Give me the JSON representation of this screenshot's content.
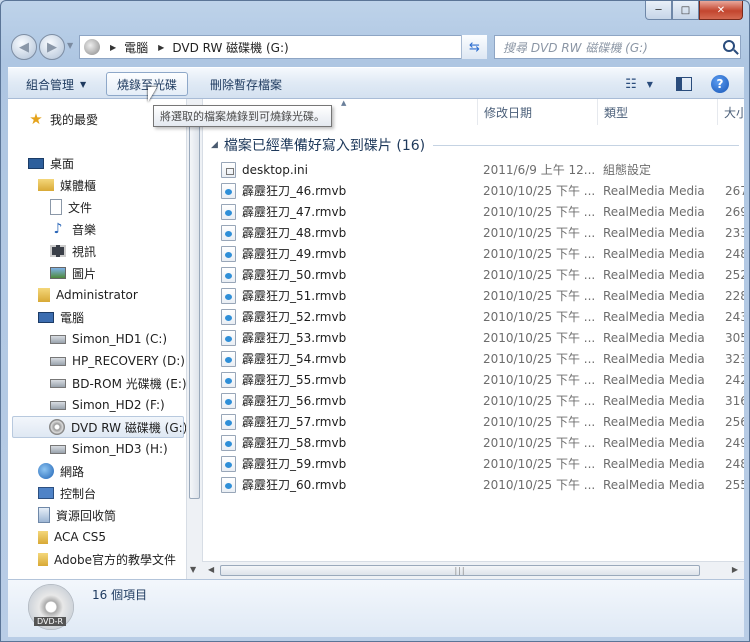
{
  "window": {
    "caption": {
      "minimize": "─",
      "maximize": "□",
      "close": "✕"
    }
  },
  "address": {
    "crumbs": [
      "電腦",
      "DVD RW 磁碟機 (G:)"
    ]
  },
  "search": {
    "placeholder": "搜尋 DVD RW 磁碟機 (G:)"
  },
  "toolbar": {
    "organize": "組合管理",
    "burn": "燒錄至光碟",
    "delete_temp": "刪除暫存檔案",
    "tooltip": "將選取的檔案燒錄到可燒錄光碟。"
  },
  "nav": {
    "items": [
      {
        "label": "我的最愛",
        "icon": "star-icon"
      },
      {
        "label": "桌面",
        "icon": "desktop-icon"
      },
      {
        "label": "媒體櫃",
        "icon": "library-icon"
      },
      {
        "label": "文件",
        "icon": "documents-icon"
      },
      {
        "label": "音樂",
        "icon": "music-icon"
      },
      {
        "label": "視訊",
        "icon": "video-icon"
      },
      {
        "label": "圖片",
        "icon": "pictures-icon"
      },
      {
        "label": "Administrator",
        "icon": "user-folder-icon"
      },
      {
        "label": "電腦",
        "icon": "computer-icon"
      },
      {
        "label": "Simon_HD1 (C:)",
        "icon": "system-drive-icon"
      },
      {
        "label": "HP_RECOVERY (D:)",
        "icon": "drive-icon"
      },
      {
        "label": "BD-ROM 光碟機 (E:)",
        "icon": "optical-drive-icon"
      },
      {
        "label": "Simon_HD2 (F:)",
        "icon": "drive-icon"
      },
      {
        "label": "DVD RW 磁碟機 (G:)",
        "icon": "dvd-drive-icon"
      },
      {
        "label": "Simon_HD3 (H:)",
        "icon": "drive-icon"
      },
      {
        "label": "網路",
        "icon": "network-icon"
      },
      {
        "label": "控制台",
        "icon": "control-panel-icon"
      },
      {
        "label": "資源回收筒",
        "icon": "recycle-bin-icon"
      },
      {
        "label": "ACA CS5",
        "icon": "folder-icon"
      },
      {
        "label": "Adobe官方的教學文件",
        "icon": "folder-icon"
      }
    ]
  },
  "columns": {
    "date": "修改日期",
    "type": "類型",
    "size": "大小"
  },
  "group": {
    "label": "檔案已經準備好寫入到碟片 (16)"
  },
  "files": [
    {
      "name": "desktop.ini",
      "date": "2011/6/9 上午 12...",
      "type": "組態設定",
      "size": "",
      "kind": "ini"
    },
    {
      "name": "霹靂狂刀_46.rmvb",
      "date": "2010/10/25 下午 ...",
      "type": "RealMedia Media",
      "size": "267",
      "kind": "media"
    },
    {
      "name": "霹靂狂刀_47.rmvb",
      "date": "2010/10/25 下午 ...",
      "type": "RealMedia Media",
      "size": "269",
      "kind": "media"
    },
    {
      "name": "霹靂狂刀_48.rmvb",
      "date": "2010/10/25 下午 ...",
      "type": "RealMedia Media",
      "size": "233",
      "kind": "media"
    },
    {
      "name": "霹靂狂刀_49.rmvb",
      "date": "2010/10/25 下午 ...",
      "type": "RealMedia Media",
      "size": "248",
      "kind": "media"
    },
    {
      "name": "霹靂狂刀_50.rmvb",
      "date": "2010/10/25 下午 ...",
      "type": "RealMedia Media",
      "size": "252",
      "kind": "media"
    },
    {
      "name": "霹靂狂刀_51.rmvb",
      "date": "2010/10/25 下午 ...",
      "type": "RealMedia Media",
      "size": "228",
      "kind": "media"
    },
    {
      "name": "霹靂狂刀_52.rmvb",
      "date": "2010/10/25 下午 ...",
      "type": "RealMedia Media",
      "size": "243",
      "kind": "media"
    },
    {
      "name": "霹靂狂刀_53.rmvb",
      "date": "2010/10/25 下午 ...",
      "type": "RealMedia Media",
      "size": "305",
      "kind": "media"
    },
    {
      "name": "霹靂狂刀_54.rmvb",
      "date": "2010/10/25 下午 ...",
      "type": "RealMedia Media",
      "size": "323",
      "kind": "media"
    },
    {
      "name": "霹靂狂刀_55.rmvb",
      "date": "2010/10/25 下午 ...",
      "type": "RealMedia Media",
      "size": "242",
      "kind": "media"
    },
    {
      "name": "霹靂狂刀_56.rmvb",
      "date": "2010/10/25 下午 ...",
      "type": "RealMedia Media",
      "size": "316",
      "kind": "media"
    },
    {
      "name": "霹靂狂刀_57.rmvb",
      "date": "2010/10/25 下午 ...",
      "type": "RealMedia Media",
      "size": "256",
      "kind": "media"
    },
    {
      "name": "霹靂狂刀_58.rmvb",
      "date": "2010/10/25 下午 ...",
      "type": "RealMedia Media",
      "size": "249",
      "kind": "media"
    },
    {
      "name": "霹靂狂刀_59.rmvb",
      "date": "2010/10/25 下午 ...",
      "type": "RealMedia Media",
      "size": "248",
      "kind": "media"
    },
    {
      "name": "霹靂狂刀_60.rmvb",
      "date": "2010/10/25 下午 ...",
      "type": "RealMedia Media",
      "size": "255",
      "kind": "media"
    }
  ],
  "status": {
    "count": "16 個項目",
    "disc_label": "DVD-R"
  },
  "colors": {
    "accent": "#1e395b",
    "selection": "#dfe8f3",
    "close": "#c3452e"
  }
}
